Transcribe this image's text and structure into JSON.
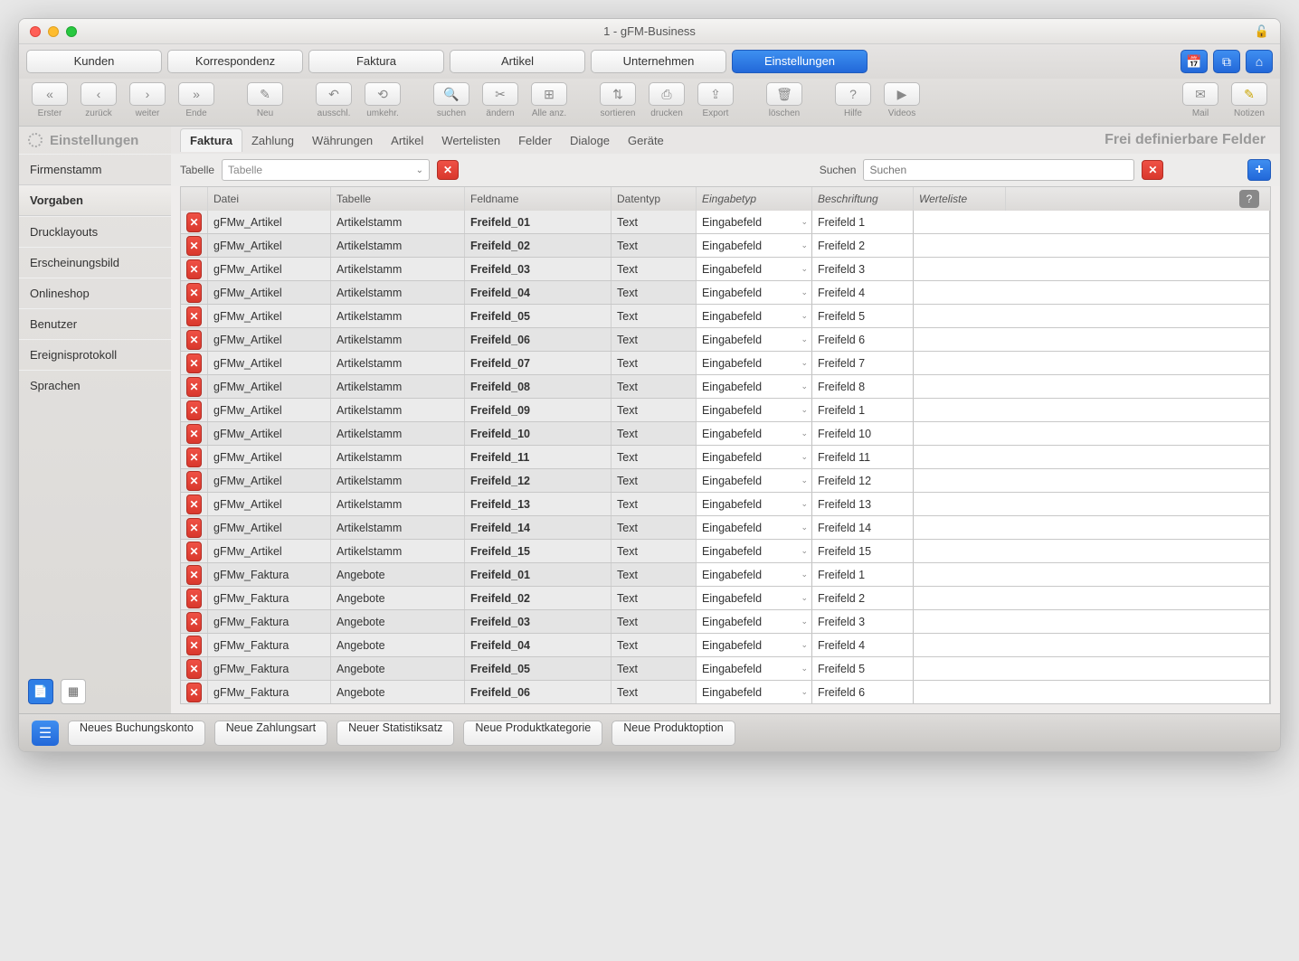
{
  "window": {
    "title": "1 - gFM-Business"
  },
  "mainnav": {
    "items": [
      "Kunden",
      "Korrespondenz",
      "Faktura",
      "Artikel",
      "Unternehmen",
      "Einstellungen"
    ],
    "active": 5
  },
  "toolbar": {
    "items": [
      {
        "label": "Erster",
        "icon": "«"
      },
      {
        "label": "zurück",
        "icon": "‹"
      },
      {
        "label": "weiter",
        "icon": "›"
      },
      {
        "label": "Ende",
        "icon": "»"
      },
      {
        "gap": true
      },
      {
        "label": "Neu",
        "icon": "✎"
      },
      {
        "gap": true
      },
      {
        "label": "ausschl.",
        "icon": "↶"
      },
      {
        "label": "umkehr.",
        "icon": "⟲"
      },
      {
        "gap": true
      },
      {
        "label": "suchen",
        "icon": "🔍"
      },
      {
        "label": "ändern",
        "icon": "✂"
      },
      {
        "label": "Alle anz.",
        "icon": "⊞"
      },
      {
        "gap": true
      },
      {
        "label": "sortieren",
        "icon": "⇅"
      },
      {
        "label": "drucken",
        "icon": "⎙"
      },
      {
        "label": "Export",
        "icon": "⇪"
      },
      {
        "gap": true
      },
      {
        "label": "löschen",
        "icon": "🗑"
      },
      {
        "gap": true
      },
      {
        "label": "Hilfe",
        "icon": "?"
      },
      {
        "label": "Videos",
        "icon": "▶"
      }
    ],
    "right": [
      {
        "label": "Mail",
        "icon": "✉"
      },
      {
        "label": "Notizen",
        "icon": "✎"
      }
    ]
  },
  "sidebar": {
    "title": "Einstellungen",
    "items": [
      "Firmenstamm",
      "Vorgaben",
      "Drucklayouts",
      "Erscheinungsbild",
      "Onlineshop",
      "Benutzer",
      "Ereignisprotokoll",
      "Sprachen"
    ],
    "active": 1
  },
  "subtabs": {
    "items": [
      "Faktura",
      "Zahlung",
      "Währungen",
      "Artikel",
      "Wertelisten",
      "Felder",
      "Dialoge",
      "Geräte"
    ],
    "active": 0,
    "pageTitle": "Frei definierbare Felder"
  },
  "filter": {
    "tableLabel": "Tabelle",
    "tablePlaceholder": "Tabelle",
    "searchLabel": "Suchen",
    "searchPlaceholder": "Suchen"
  },
  "columns": {
    "datei": "Datei",
    "tabelle": "Tabelle",
    "feldname": "Feldname",
    "datentyp": "Datentyp",
    "eingabetyp": "Eingabetyp",
    "beschriftung": "Beschriftung",
    "werteliste": "Werteliste"
  },
  "rows": [
    {
      "datei": "gFMw_Artikel",
      "tabelle": "Artikelstamm",
      "feld": "Freifeld_01",
      "dtyp": "Text",
      "etyp": "Eingabefeld",
      "beschr": "Freifeld 1",
      "wl": ""
    },
    {
      "datei": "gFMw_Artikel",
      "tabelle": "Artikelstamm",
      "feld": "Freifeld_02",
      "dtyp": "Text",
      "etyp": "Eingabefeld",
      "beschr": "Freifeld 2",
      "wl": ""
    },
    {
      "datei": "gFMw_Artikel",
      "tabelle": "Artikelstamm",
      "feld": "Freifeld_03",
      "dtyp": "Text",
      "etyp": "Eingabefeld",
      "beschr": "Freifeld 3",
      "wl": ""
    },
    {
      "datei": "gFMw_Artikel",
      "tabelle": "Artikelstamm",
      "feld": "Freifeld_04",
      "dtyp": "Text",
      "etyp": "Eingabefeld",
      "beschr": "Freifeld 4",
      "wl": ""
    },
    {
      "datei": "gFMw_Artikel",
      "tabelle": "Artikelstamm",
      "feld": "Freifeld_05",
      "dtyp": "Text",
      "etyp": "Eingabefeld",
      "beschr": "Freifeld 5",
      "wl": ""
    },
    {
      "datei": "gFMw_Artikel",
      "tabelle": "Artikelstamm",
      "feld": "Freifeld_06",
      "dtyp": "Text",
      "etyp": "Eingabefeld",
      "beschr": "Freifeld 6",
      "wl": ""
    },
    {
      "datei": "gFMw_Artikel",
      "tabelle": "Artikelstamm",
      "feld": "Freifeld_07",
      "dtyp": "Text",
      "etyp": "Eingabefeld",
      "beschr": "Freifeld 7",
      "wl": ""
    },
    {
      "datei": "gFMw_Artikel",
      "tabelle": "Artikelstamm",
      "feld": "Freifeld_08",
      "dtyp": "Text",
      "etyp": "Eingabefeld",
      "beschr": "Freifeld 8",
      "wl": ""
    },
    {
      "datei": "gFMw_Artikel",
      "tabelle": "Artikelstamm",
      "feld": "Freifeld_09",
      "dtyp": "Text",
      "etyp": "Eingabefeld",
      "beschr": "Freifeld 1",
      "wl": ""
    },
    {
      "datei": "gFMw_Artikel",
      "tabelle": "Artikelstamm",
      "feld": "Freifeld_10",
      "dtyp": "Text",
      "etyp": "Eingabefeld",
      "beschr": "Freifeld 10",
      "wl": ""
    },
    {
      "datei": "gFMw_Artikel",
      "tabelle": "Artikelstamm",
      "feld": "Freifeld_11",
      "dtyp": "Text",
      "etyp": "Eingabefeld",
      "beschr": "Freifeld 11",
      "wl": ""
    },
    {
      "datei": "gFMw_Artikel",
      "tabelle": "Artikelstamm",
      "feld": "Freifeld_12",
      "dtyp": "Text",
      "etyp": "Eingabefeld",
      "beschr": "Freifeld 12",
      "wl": ""
    },
    {
      "datei": "gFMw_Artikel",
      "tabelle": "Artikelstamm",
      "feld": "Freifeld_13",
      "dtyp": "Text",
      "etyp": "Eingabefeld",
      "beschr": "Freifeld 13",
      "wl": ""
    },
    {
      "datei": "gFMw_Artikel",
      "tabelle": "Artikelstamm",
      "feld": "Freifeld_14",
      "dtyp": "Text",
      "etyp": "Eingabefeld",
      "beschr": "Freifeld 14",
      "wl": ""
    },
    {
      "datei": "gFMw_Artikel",
      "tabelle": "Artikelstamm",
      "feld": "Freifeld_15",
      "dtyp": "Text",
      "etyp": "Eingabefeld",
      "beschr": "Freifeld 15",
      "wl": ""
    },
    {
      "datei": "gFMw_Faktura",
      "tabelle": "Angebote",
      "feld": "Freifeld_01",
      "dtyp": "Text",
      "etyp": "Eingabefeld",
      "beschr": "Freifeld 1",
      "wl": ""
    },
    {
      "datei": "gFMw_Faktura",
      "tabelle": "Angebote",
      "feld": "Freifeld_02",
      "dtyp": "Text",
      "etyp": "Eingabefeld",
      "beschr": "Freifeld 2",
      "wl": ""
    },
    {
      "datei": "gFMw_Faktura",
      "tabelle": "Angebote",
      "feld": "Freifeld_03",
      "dtyp": "Text",
      "etyp": "Eingabefeld",
      "beschr": "Freifeld 3",
      "wl": ""
    },
    {
      "datei": "gFMw_Faktura",
      "tabelle": "Angebote",
      "feld": "Freifeld_04",
      "dtyp": "Text",
      "etyp": "Eingabefeld",
      "beschr": "Freifeld 4",
      "wl": ""
    },
    {
      "datei": "gFMw_Faktura",
      "tabelle": "Angebote",
      "feld": "Freifeld_05",
      "dtyp": "Text",
      "etyp": "Eingabefeld",
      "beschr": "Freifeld 5",
      "wl": ""
    },
    {
      "datei": "gFMw_Faktura",
      "tabelle": "Angebote",
      "feld": "Freifeld_06",
      "dtyp": "Text",
      "etyp": "Eingabefeld",
      "beschr": "Freifeld 6",
      "wl": ""
    }
  ],
  "footer": {
    "buttons": [
      "Neues Buchungskonto",
      "Neue Zahlungsart",
      "Neuer Statistiksatz",
      "Neue Produktkategorie",
      "Neue Produktoption"
    ]
  }
}
